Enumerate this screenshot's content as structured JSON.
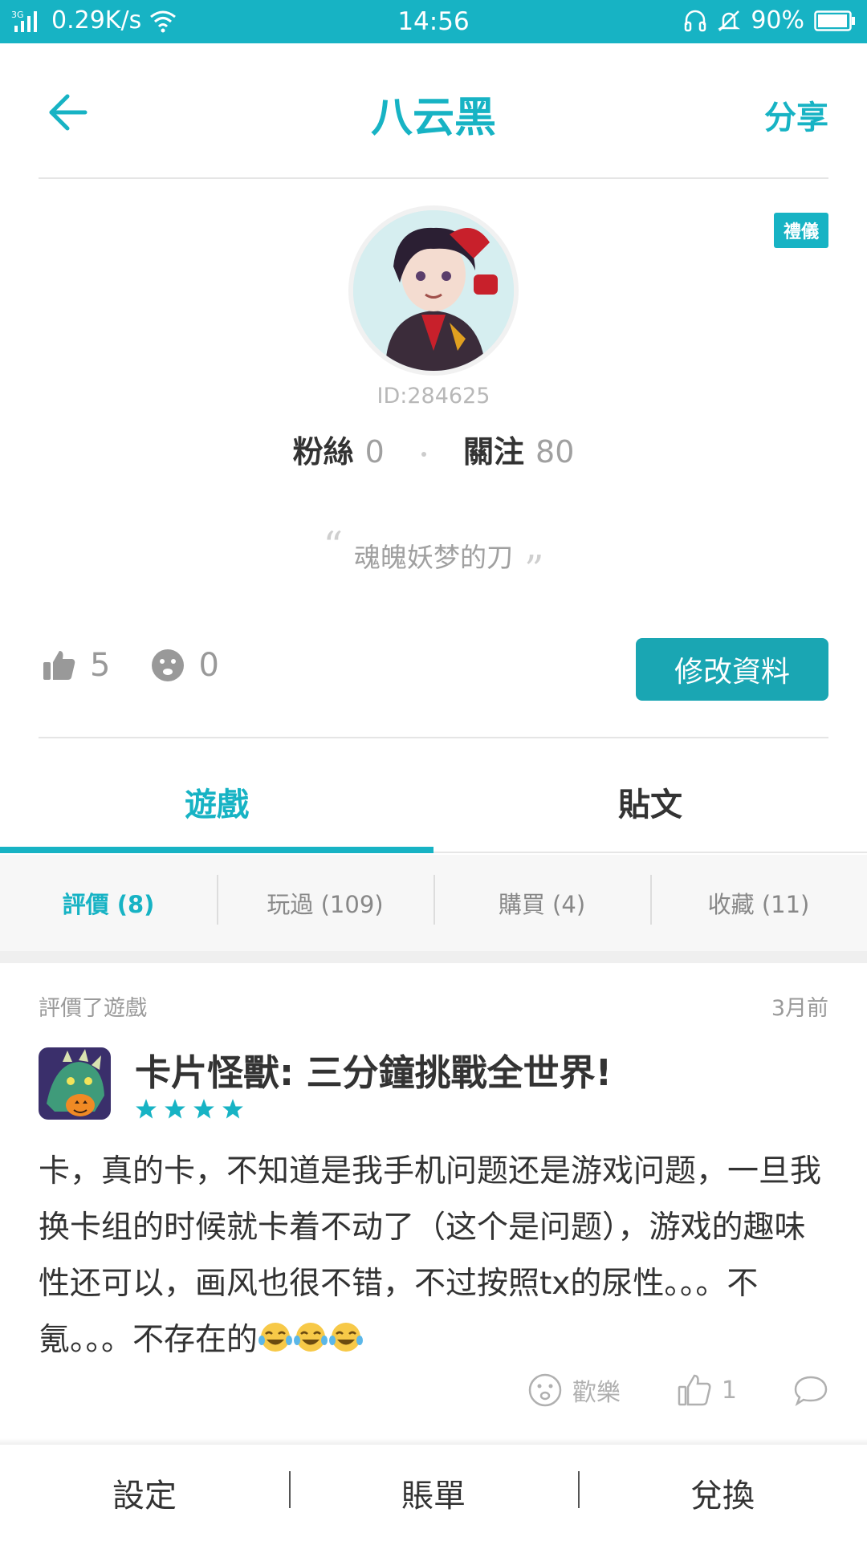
{
  "status_bar": {
    "network": "3G",
    "speed": "0.29K/s",
    "time": "14:56",
    "battery": "90%"
  },
  "header": {
    "title": "八云黑",
    "share_label": "分享"
  },
  "profile": {
    "badge": "禮儀",
    "id": "ID:284625",
    "fans_label": "粉絲",
    "fans_count": "0",
    "follow_label": "關注",
    "follow_count": "80",
    "quote_open": "“",
    "quote_close": "”",
    "signature": "魂魄妖梦的刀",
    "likes": "5",
    "dislikes": "0",
    "edit_label": "修改資料"
  },
  "tabs": [
    {
      "label": "遊戲",
      "active": true
    },
    {
      "label": "貼文",
      "active": false
    }
  ],
  "subtabs": [
    {
      "label": "評價 (8)",
      "active": true
    },
    {
      "label": "玩過 (109)",
      "active": false
    },
    {
      "label": "購買 (4)",
      "active": false
    },
    {
      "label": "收藏 (11)",
      "active": false
    }
  ],
  "review": {
    "meta": "評價了遊戲",
    "time": "3月前",
    "game_title": "卡片怪獸: 三分鐘挑戰全世界!",
    "rating": 4,
    "text": "卡，真的卡，不知道是我手机问题还是游戏问题，一旦我换卡组的时候就卡着不动了（这个是问题），游戏的趣味性还可以，画风也很不错，不过按照tx的尿性。。。不氪。。。不存在的",
    "emoji_count": 3,
    "fun_label": "歡樂",
    "like_count": "1"
  },
  "bottom_nav": [
    {
      "label": "設定"
    },
    {
      "label": "賬單"
    },
    {
      "label": "兌換"
    }
  ],
  "colors": {
    "accent": "#17b3c4",
    "button": "#1aa6b3",
    "star": "#17b3c4"
  }
}
